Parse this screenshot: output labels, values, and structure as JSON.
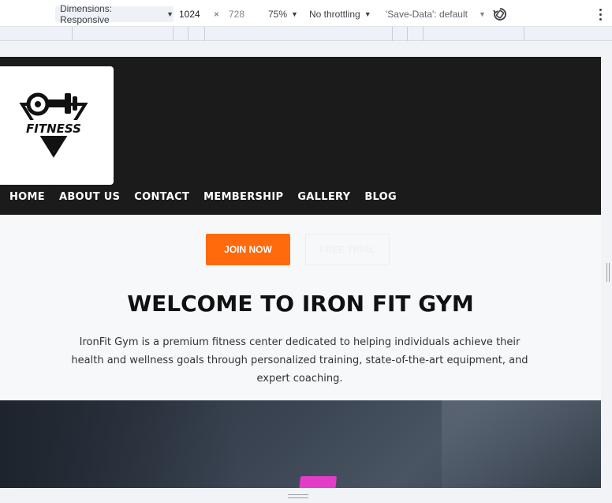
{
  "devtools": {
    "dimensions_label": "Dimensions: Responsive",
    "width_value": "1024",
    "height_value": "728",
    "times": "×",
    "zoom": "75%",
    "throttling": "No throttling",
    "save_data": "'Save-Data': default"
  },
  "site": {
    "logo_text": "FITNESS",
    "nav": [
      "HOME",
      "ABOUT US",
      "CONTACT",
      "MEMBERSHIP",
      "GALLERY",
      "BLOG"
    ],
    "join_button": "JOIN NOW",
    "trial_button": "FREE TRIAL",
    "heading": "WELCOME TO IRON FIT GYM",
    "intro": "IronFit Gym is a premium fitness center dedicated to helping individuals achieve their health and wellness goals through personalized training, state-of-the-art equipment, and expert coaching."
  },
  "colors": {
    "header_bg": "#1b1b1b",
    "accent_orange": "#ff6a0d"
  }
}
